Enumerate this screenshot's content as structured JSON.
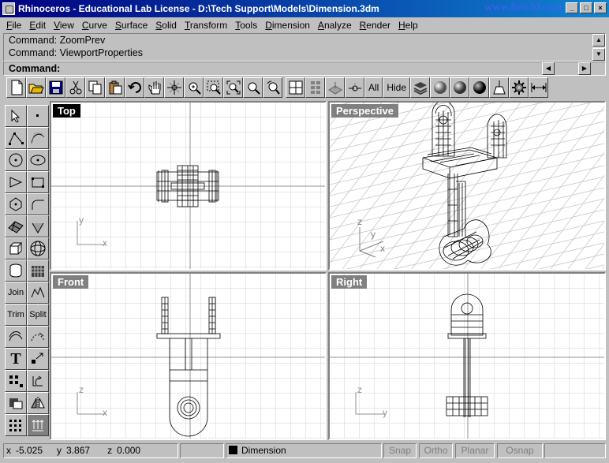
{
  "window": {
    "title": "Rhinoceros - Educational Lab License - D:\\Tech Support\\Models\\Dimension.3dm",
    "watermark": "www.foro3d.com",
    "minimize": "_",
    "maximize": "□",
    "close": "×"
  },
  "menu": [
    {
      "key": "F",
      "rest": "ile"
    },
    {
      "key": "E",
      "rest": "dit"
    },
    {
      "key": "V",
      "rest": "iew"
    },
    {
      "key": "C",
      "rest": "urve"
    },
    {
      "key": "S",
      "rest": "urface"
    },
    {
      "key": "S",
      "rest": "olid"
    },
    {
      "key": "T",
      "rest": "ransform"
    },
    {
      "key": "T",
      "rest": "ools"
    },
    {
      "key": "D",
      "rest": "imension"
    },
    {
      "key": "A",
      "rest": "nalyze"
    },
    {
      "key": "R",
      "rest": "ender"
    },
    {
      "key": "H",
      "rest": "elp"
    }
  ],
  "command_history": [
    "Command: ZoomPrev",
    "Command: ViewportProperties"
  ],
  "command_prompt": "Command:",
  "toolbar_text": {
    "all": "All",
    "hide": "Hide"
  },
  "toolbar_icons": [
    "new-icon",
    "open-icon",
    "save-icon",
    "cut-icon",
    "copy-icon",
    "paste-icon",
    "undo-icon",
    "pan-icon",
    "rotate-view-icon",
    "zoom-in-icon",
    "zoom-window-icon",
    "zoom-extents-icon",
    "zoom-selected-icon",
    "zoom-previous-icon",
    "four-viewports-icon",
    "grid-icon",
    "plane-icon",
    "cplane-icon",
    "layer-icon",
    "shade-icon",
    "render-icon",
    "render-preview-icon",
    "light-icon",
    "options-icon",
    "dimension-icon"
  ],
  "left_tools": {
    "join": "Join",
    "trim": "Trim",
    "split": "Split",
    "text": "T"
  },
  "viewports": {
    "top": {
      "label": "Top",
      "axis_x": "x",
      "axis_y": "y"
    },
    "perspective": {
      "label": "Perspective",
      "axis_x": "x",
      "axis_y": "y",
      "axis_z": "z"
    },
    "front": {
      "label": "Front",
      "axis_x": "x",
      "axis_z": "z"
    },
    "right": {
      "label": "Right",
      "axis_y": "y",
      "axis_z": "z"
    }
  },
  "status": {
    "x_label": "x",
    "x": "-5.025",
    "y_label": "y",
    "y": "3.867",
    "z_label": "z",
    "z": "0.000",
    "layer": "Dimension",
    "snap": "Snap",
    "ortho": "Ortho",
    "planar": "Planar",
    "osnap": "Osnap"
  }
}
